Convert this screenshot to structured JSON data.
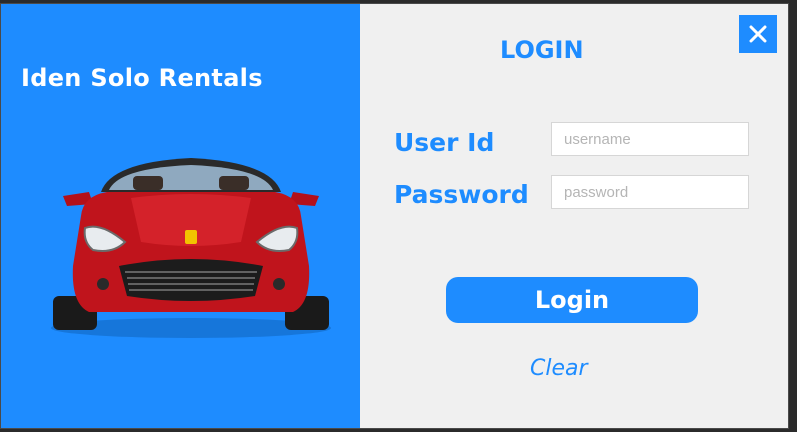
{
  "app": {
    "brand_title": "Iden Solo Rentals",
    "heading": "LOGIN",
    "close_label": "X"
  },
  "form": {
    "user_id_label": "User Id",
    "user_id_placeholder": "username",
    "user_id_value": "",
    "password_label": "Password",
    "password_placeholder": "password",
    "password_value": "",
    "login_button_label": "Login",
    "clear_label": "Clear"
  },
  "icons": {
    "close": "close-icon",
    "car": "car-image"
  },
  "colors": {
    "accent": "#1e8cff",
    "panel_bg": "#f0f0f0",
    "car_body": "#c0141c"
  }
}
